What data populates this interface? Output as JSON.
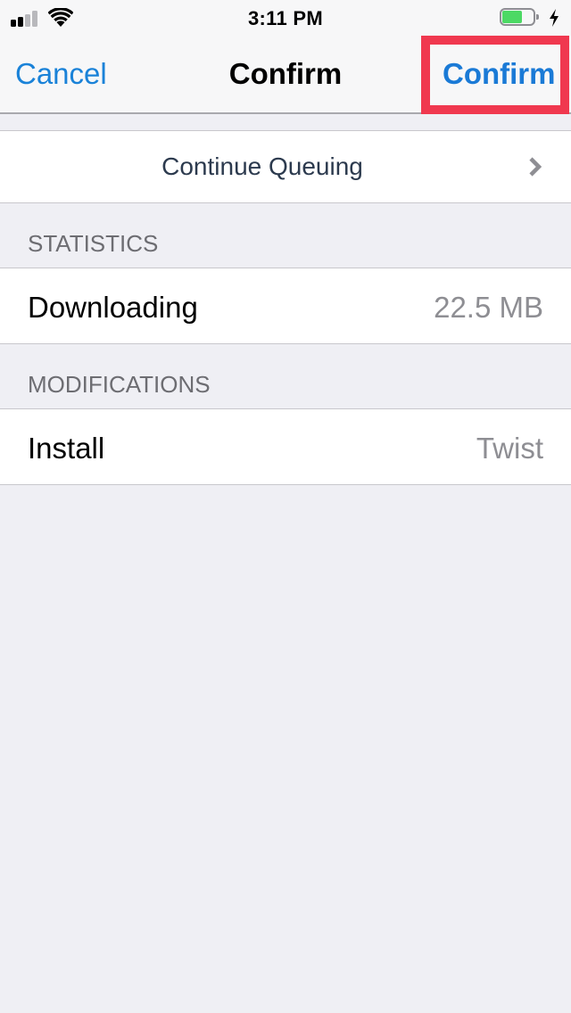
{
  "status_bar": {
    "time": "3:11 PM",
    "signal_bars_active": 2,
    "signal_bars_total": 4,
    "wifi_icon": "wifi-icon",
    "battery_level_percent": 65,
    "battery_charging": true,
    "colors": {
      "battery_fill": "#4cd964"
    }
  },
  "nav": {
    "cancel_label": "Cancel",
    "title": "Confirm",
    "confirm_label": "Confirm",
    "colors": {
      "tint": "#1a82d8",
      "highlight_box": "#f0384f"
    }
  },
  "queue": {
    "label": "Continue Queuing",
    "icon": "chevron-right-icon"
  },
  "sections": {
    "statistics": {
      "header": "STATISTICS",
      "rows": [
        {
          "label": "Downloading",
          "value": "22.5 MB"
        }
      ]
    },
    "modifications": {
      "header": "MODIFICATIONS",
      "rows": [
        {
          "label": "Install",
          "value": "Twist"
        }
      ]
    }
  }
}
